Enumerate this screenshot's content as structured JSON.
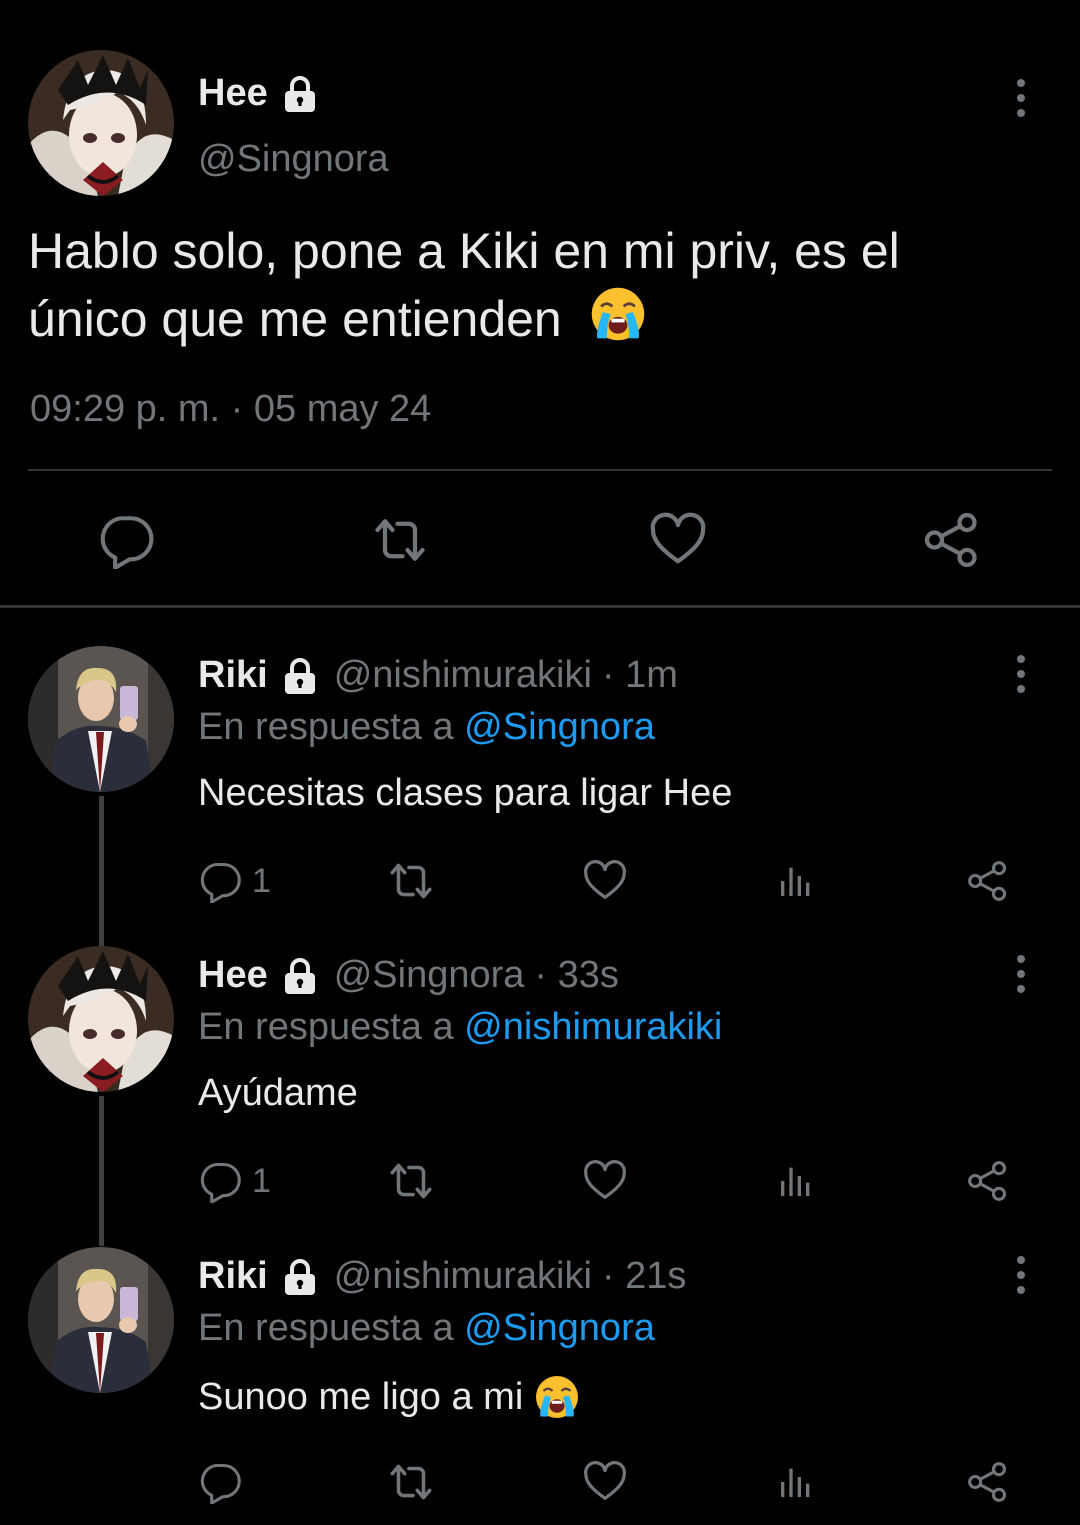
{
  "main_tweet": {
    "author_name": "Hee",
    "author_handle": "@Singnora",
    "text": "Hablo solo, pone a Kiki en mi priv, es el único que me entienden",
    "emoji": "loudly-crying-face",
    "timestamp": "09:29 p. m. · 05 may 24"
  },
  "replies": [
    {
      "author_name": "Riki",
      "author_handle": "@nishimurakiki",
      "time": "· 1m",
      "reply_prefix": "En respuesta a",
      "reply_to": "@Singnora",
      "text": "Necesitas clases para ligar Hee",
      "reply_count": "1"
    },
    {
      "author_name": "Hee",
      "author_handle": "@Singnora",
      "time": "· 33s",
      "reply_prefix": "En respuesta a",
      "reply_to": "@nishimurakiki",
      "text": "Ayúdame",
      "reply_count": "1"
    },
    {
      "author_name": "Riki",
      "author_handle": "@nishimurakiki",
      "time": "· 21s",
      "reply_prefix": "En respuesta a",
      "reply_to": "@Singnora",
      "text": "Sunoo me ligo a mi",
      "emoji": "loudly-crying-face",
      "reply_count": ""
    }
  ],
  "colors": {
    "background": "#000000",
    "text_primary": "#e7e9ea",
    "text_secondary": "#71767b",
    "link": "#1d9bf0",
    "divider": "#2f3336"
  }
}
